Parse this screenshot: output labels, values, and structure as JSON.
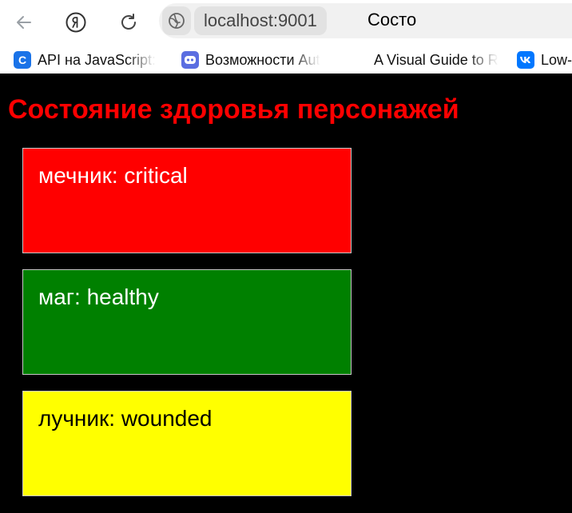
{
  "browser": {
    "url": "localhost:9001",
    "tab_title": "Состо",
    "bookmarks": [
      {
        "label": "API на JavaScript: ",
        "icon": "c-logo-icon",
        "color": "#1a73e8"
      },
      {
        "label": "Возможности Aut",
        "icon": "robot-icon",
        "color": "#5b6ee1"
      },
      {
        "label": "A Visual Guide to R",
        "icon": "",
        "color": ""
      },
      {
        "label": "Low-",
        "icon": "vk-logo-icon",
        "color": "#0077ff"
      }
    ]
  },
  "page": {
    "background": "#000000",
    "heading": "Состояние здоровья персонажей",
    "heading_color": "#ff0000",
    "characters": [
      {
        "text": "мечник: critical",
        "status": "critical",
        "background": "#ff0000",
        "text_color": "#ffffff"
      },
      {
        "text": "маг: healthy",
        "status": "healthy",
        "background": "#008000",
        "text_color": "#ffffff"
      },
      {
        "text": "лучник: wounded",
        "status": "wounded",
        "background": "#ffff00",
        "text_color": "#000000"
      }
    ]
  }
}
